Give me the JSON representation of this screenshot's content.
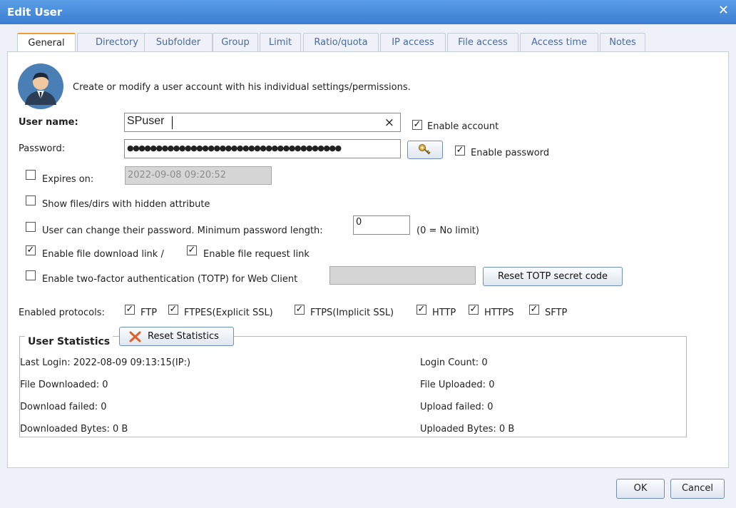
{
  "window": {
    "title": "Edit User",
    "close_icon": "✕"
  },
  "tabs": [
    {
      "label": "General"
    },
    {
      "label": "Directory"
    },
    {
      "label": "Subfolder"
    },
    {
      "label": "Group"
    },
    {
      "label": "Limit"
    },
    {
      "label": "Ratio/quota"
    },
    {
      "label": "IP access"
    },
    {
      "label": "File access"
    },
    {
      "label": "Access time"
    },
    {
      "label": "Notes"
    }
  ],
  "general": {
    "intro": "Create or modify a user account with his individual settings/permissions.",
    "username_label": "User name:",
    "username_value": "SPuser",
    "clear_icon": "×",
    "enable_account_label": "Enable account",
    "password_label": "Password:",
    "password_value": "●●●●●●●●●●●●●●●●●●●●●●●●●●●●●●●●●●●●●",
    "enable_password_label": "Enable password",
    "expires_label": "Expires on:",
    "expires_value": "2022-09-08 09:20:52",
    "show_hidden_label": "Show files/dirs with hidden attribute",
    "change_pw_label": "User can change their password. Minimum password length:",
    "min_pw_value": "0",
    "min_pw_note": "(0 = No limit)",
    "download_link_label": "Enable file download link /",
    "request_link_label": "Enable file request link",
    "totp_label": "Enable two-factor authentication (TOTP) for Web Client",
    "reset_totp_label": "Reset TOTP secret code",
    "protocols_label": "Enabled protocols:",
    "protocols": [
      "FTP",
      "FTPES(Explicit SSL)",
      "FTPS(Implicit SSL)",
      "HTTP",
      "HTTPS",
      "SFTP"
    ]
  },
  "stats": {
    "title": "User Statistics",
    "reset_label": "Reset Statistics",
    "last_login": "Last Login: 2022-08-09 09:13:15(IP:)",
    "login_count": "Login Count: 0",
    "file_downloaded": "File Downloaded: 0",
    "file_uploaded": "File Uploaded: 0",
    "download_failed": "Download failed: 0",
    "upload_failed": "Upload failed: 0",
    "downloaded_bytes": "Downloaded Bytes: 0 B",
    "uploaded_bytes": "Uploaded Bytes: 0 B"
  },
  "footer": {
    "ok_label": "OK",
    "cancel_label": "Cancel"
  },
  "colors": {
    "titlebar": "#3b7ed3",
    "tab_active_accent": "#f0a030"
  }
}
